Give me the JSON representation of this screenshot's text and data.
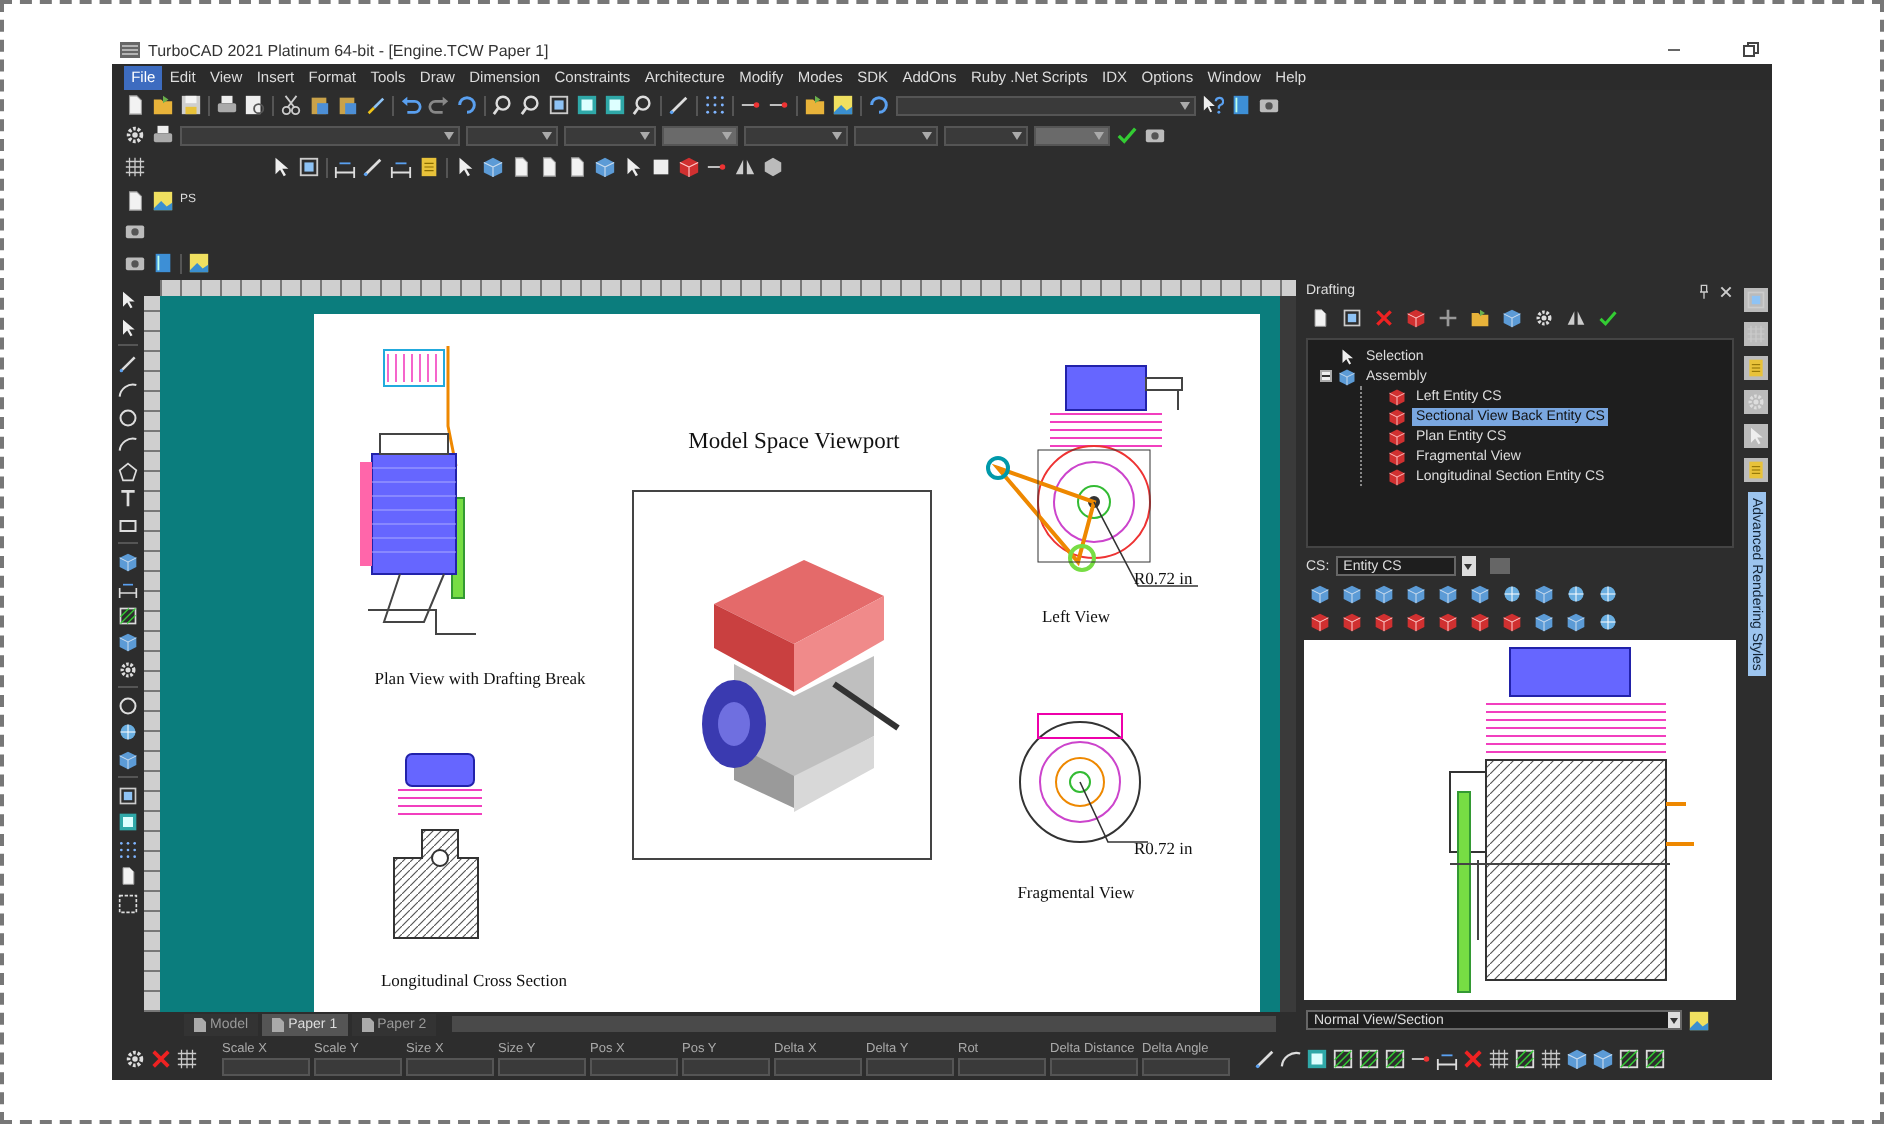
{
  "window": {
    "title": "TurboCAD 2021 Platinum 64-bit - [Engine.TCW Paper 1]"
  },
  "menu": [
    {
      "label": "File",
      "selected": true
    },
    {
      "label": "Edit",
      "selected": false
    },
    {
      "label": "View",
      "selected": false
    },
    {
      "label": "Insert",
      "selected": false
    },
    {
      "label": "Format",
      "selected": false
    },
    {
      "label": "Tools",
      "selected": false
    },
    {
      "label": "Draw",
      "selected": false
    },
    {
      "label": "Dimension",
      "selected": false
    },
    {
      "label": "Constraints",
      "selected": false
    },
    {
      "label": "Architecture",
      "selected": false
    },
    {
      "label": "Modify",
      "selected": false
    },
    {
      "label": "Modes",
      "selected": false
    },
    {
      "label": "SDK",
      "selected": false
    },
    {
      "label": "AddOns",
      "selected": false
    },
    {
      "label": "Ruby .Net Scripts",
      "selected": false
    },
    {
      "label": "IDX",
      "selected": false
    },
    {
      "label": "Options",
      "selected": false
    },
    {
      "label": "Window",
      "selected": false
    },
    {
      "label": "Help",
      "selected": false
    }
  ],
  "toolbar_text": "PS",
  "paper": {
    "labels": [
      {
        "kind": "title",
        "text": "Model Space Viewport"
      },
      {
        "kind": "caption",
        "text": "Plan View with Drafting Break"
      },
      {
        "kind": "caption",
        "text": "Left View"
      },
      {
        "kind": "dimension",
        "text": "R0.72 in"
      },
      {
        "kind": "caption",
        "text": "Fragmental View"
      },
      {
        "kind": "dimension",
        "text": "R0.72 in"
      },
      {
        "kind": "caption",
        "text": "Longitudinal Cross Section"
      }
    ]
  },
  "document_tabs": [
    {
      "label": "Model",
      "selected": false
    },
    {
      "label": "Paper 1",
      "selected": true
    },
    {
      "label": "Paper 2",
      "selected": false
    }
  ],
  "drafting": {
    "title": "Drafting",
    "tree": [
      {
        "label": "Selection",
        "selected": false
      },
      {
        "label": "Assembly",
        "selected": false,
        "expanded": true,
        "children": [
          {
            "label": "Left Entity CS",
            "selected": false
          },
          {
            "label": "Sectional View Back Entity CS",
            "selected": true
          },
          {
            "label": "Plan Entity CS",
            "selected": false
          },
          {
            "label": "Fragmental View",
            "selected": false
          },
          {
            "label": "Longitudinal Section Entity CS",
            "selected": false
          }
        ]
      }
    ],
    "cs_label": "CS:",
    "cs_value": "Entity CS",
    "view_mode": "Normal View/Section"
  },
  "side_tab": "Advanced Rendering Styles",
  "status_fields": [
    "Scale X",
    "Scale Y",
    "Size X",
    "Size Y",
    "Pos X",
    "Pos Y",
    "Delta X",
    "Delta Y",
    "Rot",
    "Delta Distance",
    "Delta Angle"
  ]
}
